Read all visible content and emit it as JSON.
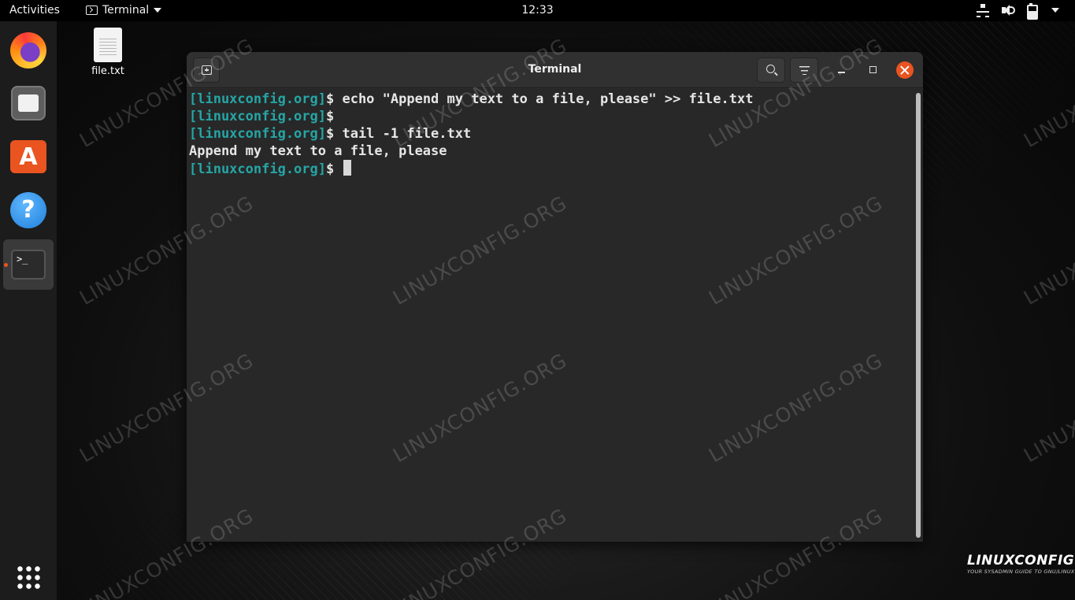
{
  "topbar": {
    "activities_label": "Activities",
    "app_name": "Terminal",
    "clock": "12:33"
  },
  "dock": {
    "items": [
      {
        "name": "Firefox",
        "icon": "firefox-icon"
      },
      {
        "name": "Files",
        "icon": "files-icon"
      },
      {
        "name": "Ubuntu Software",
        "icon": "software-icon",
        "glyph": "A"
      },
      {
        "name": "Help",
        "icon": "help-icon",
        "glyph": "?"
      },
      {
        "name": "Terminal",
        "icon": "terminal-icon",
        "glyph": ">_",
        "active": true
      }
    ],
    "show_apps_icon": "apps-grid-icon"
  },
  "desktop": {
    "file_label": "file.txt"
  },
  "window": {
    "title": "Terminal",
    "accent_color": "#e95420"
  },
  "terminal": {
    "prompt": "[linuxconfig.org]",
    "prompt_color": "#26a5a5",
    "lines": [
      {
        "prompt": "[linuxconfig.org]",
        "rest": "$ echo \"Append my text to a file, please\" >> file.txt"
      },
      {
        "prompt": "[linuxconfig.org]",
        "rest": "$"
      },
      {
        "prompt": "[linuxconfig.org]",
        "rest": "$ tail -1 file.txt"
      },
      {
        "prompt": "",
        "rest": "Append my text to a file, please"
      },
      {
        "prompt": "[linuxconfig.org]",
        "rest": "$ "
      }
    ]
  },
  "watermark": "LINUXCONFIG.ORG",
  "brand": {
    "logo": "LINUXCONFIG.ORG",
    "tagline": "YOUR SYSADMIN GUIDE TO GNU/LINUX"
  }
}
